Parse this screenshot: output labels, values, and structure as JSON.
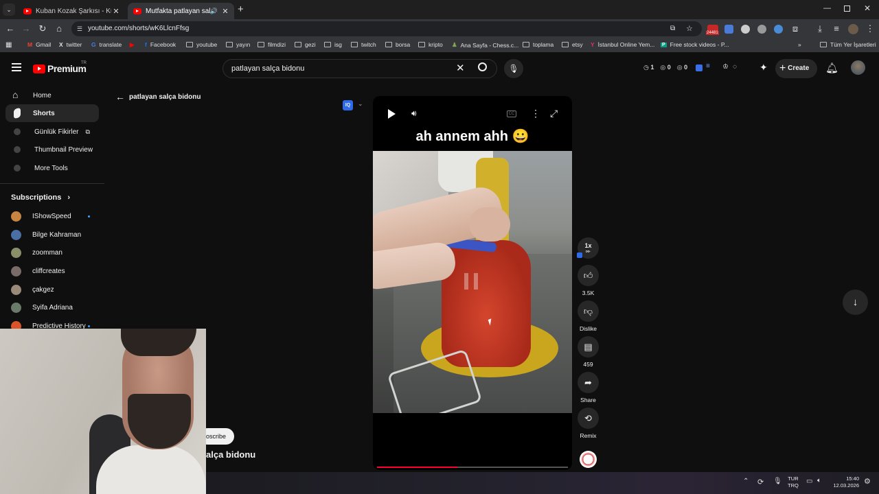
{
  "browser": {
    "tabs": [
      {
        "title": "Kuban Kozak Şarkısı - Kuban Co",
        "active": false
      },
      {
        "title": "Mutfakta patlayan salça bidonu",
        "active": true
      }
    ],
    "url": "youtube.com/shorts/wK6LlcnFfsg",
    "ext_badge": "24481",
    "bookmarks": [
      "Gmail",
      "twitter",
      "translate",
      "Facebook",
      "youtube",
      "yayın",
      "filmdizi",
      "gezi",
      "isg",
      "twitch",
      "borsa",
      "kripto",
      "Ana Sayfa - Chess.c...",
      "toplama",
      "etsy",
      "İstanbul Online Yem...",
      "Free stock videos - P..."
    ],
    "all_bookmarks": "Tüm Yer İşaretleri"
  },
  "header": {
    "logo": "Premium",
    "region": "TR",
    "search_value": "patlayan salça bidonu",
    "stats": [
      "1",
      "0",
      "0"
    ],
    "create_label": "Create"
  },
  "sidebar": {
    "items": [
      {
        "label": "Home"
      },
      {
        "label": "Shorts"
      },
      {
        "label": "Günlük Fikirler"
      },
      {
        "label": "Thumbnail Preview"
      },
      {
        "label": "More Tools"
      }
    ],
    "subscriptions_title": "Subscriptions",
    "subscriptions": [
      {
        "name": "IShowSpeed",
        "color": "#c8853f"
      },
      {
        "name": "Bilge Kahraman",
        "color": "#4a6fa5"
      },
      {
        "name": "zoomman",
        "color": "#8a8f6a"
      },
      {
        "name": "cliffcreates",
        "color": "#7a6a6a"
      },
      {
        "name": "çakgez",
        "color": "#9a8a7a"
      },
      {
        "name": "Syifa Adriana",
        "color": "#6a7a6a"
      },
      {
        "name": "Predictive History",
        "color": "#d9542b"
      }
    ]
  },
  "back_label": "patlayan salça bidonu",
  "video": {
    "caption": "ah annem ahh 😀",
    "progress": 0.42,
    "subscribe_partial": "oscribe",
    "title_partial": "alça bidonu"
  },
  "actions": {
    "speed": "1x",
    "likes": "3.5K",
    "dislike": "Dislike",
    "comments": "459",
    "share": "Share",
    "remix": "Remix"
  },
  "taskbar": {
    "lang_top": "TUR",
    "lang_bottom": "TRQ",
    "time": "15:40",
    "date": "12.03.2026"
  }
}
